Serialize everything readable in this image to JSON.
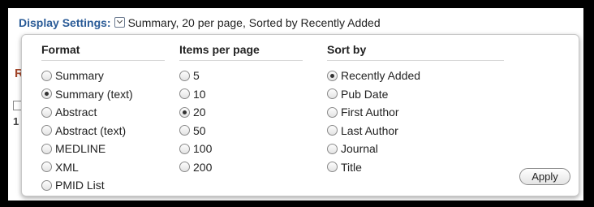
{
  "display_settings": {
    "label": "Display Settings:",
    "summary": "Summary, 20 per page, Sorted by Recently Added"
  },
  "background_fragments": {
    "r": "R",
    "one": "1"
  },
  "format": {
    "heading": "Format",
    "options": [
      "Summary",
      "Summary (text)",
      "Abstract",
      "Abstract (text)",
      "MEDLINE",
      "XML",
      "PMID List"
    ],
    "selected": "Summary (text)"
  },
  "items_per_page": {
    "heading": "Items per page",
    "options": [
      "5",
      "10",
      "20",
      "50",
      "100",
      "200"
    ],
    "selected": "20"
  },
  "sort_by": {
    "heading": "Sort by",
    "options": [
      "Recently Added",
      "Pub Date",
      "First Author",
      "Last Author",
      "Journal",
      "Title"
    ],
    "selected": "Recently Added"
  },
  "apply_label": "Apply"
}
